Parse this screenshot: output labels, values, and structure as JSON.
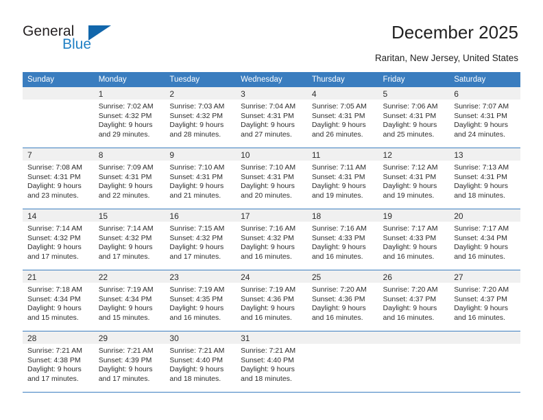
{
  "brand": {
    "general": "General",
    "blue": "Blue",
    "triangle_color": "#1166ab",
    "blue_color": "#1f7fc4"
  },
  "header": {
    "title": "December 2025",
    "subtitle": "Raritan, New Jersey, United States",
    "header_bg": "#3a7dbf"
  },
  "weekdays": [
    "Sunday",
    "Monday",
    "Tuesday",
    "Wednesday",
    "Thursday",
    "Friday",
    "Saturday"
  ],
  "weeks": [
    [
      {
        "day": "",
        "sunrise": "",
        "sunset": "",
        "daylight1": "",
        "daylight2": ""
      },
      {
        "day": "1",
        "sunrise": "Sunrise: 7:02 AM",
        "sunset": "Sunset: 4:32 PM",
        "daylight1": "Daylight: 9 hours",
        "daylight2": "and 29 minutes."
      },
      {
        "day": "2",
        "sunrise": "Sunrise: 7:03 AM",
        "sunset": "Sunset: 4:32 PM",
        "daylight1": "Daylight: 9 hours",
        "daylight2": "and 28 minutes."
      },
      {
        "day": "3",
        "sunrise": "Sunrise: 7:04 AM",
        "sunset": "Sunset: 4:31 PM",
        "daylight1": "Daylight: 9 hours",
        "daylight2": "and 27 minutes."
      },
      {
        "day": "4",
        "sunrise": "Sunrise: 7:05 AM",
        "sunset": "Sunset: 4:31 PM",
        "daylight1": "Daylight: 9 hours",
        "daylight2": "and 26 minutes."
      },
      {
        "day": "5",
        "sunrise": "Sunrise: 7:06 AM",
        "sunset": "Sunset: 4:31 PM",
        "daylight1": "Daylight: 9 hours",
        "daylight2": "and 25 minutes."
      },
      {
        "day": "6",
        "sunrise": "Sunrise: 7:07 AM",
        "sunset": "Sunset: 4:31 PM",
        "daylight1": "Daylight: 9 hours",
        "daylight2": "and 24 minutes."
      }
    ],
    [
      {
        "day": "7",
        "sunrise": "Sunrise: 7:08 AM",
        "sunset": "Sunset: 4:31 PM",
        "daylight1": "Daylight: 9 hours",
        "daylight2": "and 23 minutes."
      },
      {
        "day": "8",
        "sunrise": "Sunrise: 7:09 AM",
        "sunset": "Sunset: 4:31 PM",
        "daylight1": "Daylight: 9 hours",
        "daylight2": "and 22 minutes."
      },
      {
        "day": "9",
        "sunrise": "Sunrise: 7:10 AM",
        "sunset": "Sunset: 4:31 PM",
        "daylight1": "Daylight: 9 hours",
        "daylight2": "and 21 minutes."
      },
      {
        "day": "10",
        "sunrise": "Sunrise: 7:10 AM",
        "sunset": "Sunset: 4:31 PM",
        "daylight1": "Daylight: 9 hours",
        "daylight2": "and 20 minutes."
      },
      {
        "day": "11",
        "sunrise": "Sunrise: 7:11 AM",
        "sunset": "Sunset: 4:31 PM",
        "daylight1": "Daylight: 9 hours",
        "daylight2": "and 19 minutes."
      },
      {
        "day": "12",
        "sunrise": "Sunrise: 7:12 AM",
        "sunset": "Sunset: 4:31 PM",
        "daylight1": "Daylight: 9 hours",
        "daylight2": "and 19 minutes."
      },
      {
        "day": "13",
        "sunrise": "Sunrise: 7:13 AM",
        "sunset": "Sunset: 4:31 PM",
        "daylight1": "Daylight: 9 hours",
        "daylight2": "and 18 minutes."
      }
    ],
    [
      {
        "day": "14",
        "sunrise": "Sunrise: 7:14 AM",
        "sunset": "Sunset: 4:32 PM",
        "daylight1": "Daylight: 9 hours",
        "daylight2": "and 17 minutes."
      },
      {
        "day": "15",
        "sunrise": "Sunrise: 7:14 AM",
        "sunset": "Sunset: 4:32 PM",
        "daylight1": "Daylight: 9 hours",
        "daylight2": "and 17 minutes."
      },
      {
        "day": "16",
        "sunrise": "Sunrise: 7:15 AM",
        "sunset": "Sunset: 4:32 PM",
        "daylight1": "Daylight: 9 hours",
        "daylight2": "and 17 minutes."
      },
      {
        "day": "17",
        "sunrise": "Sunrise: 7:16 AM",
        "sunset": "Sunset: 4:32 PM",
        "daylight1": "Daylight: 9 hours",
        "daylight2": "and 16 minutes."
      },
      {
        "day": "18",
        "sunrise": "Sunrise: 7:16 AM",
        "sunset": "Sunset: 4:33 PM",
        "daylight1": "Daylight: 9 hours",
        "daylight2": "and 16 minutes."
      },
      {
        "day": "19",
        "sunrise": "Sunrise: 7:17 AM",
        "sunset": "Sunset: 4:33 PM",
        "daylight1": "Daylight: 9 hours",
        "daylight2": "and 16 minutes."
      },
      {
        "day": "20",
        "sunrise": "Sunrise: 7:17 AM",
        "sunset": "Sunset: 4:34 PM",
        "daylight1": "Daylight: 9 hours",
        "daylight2": "and 16 minutes."
      }
    ],
    [
      {
        "day": "21",
        "sunrise": "Sunrise: 7:18 AM",
        "sunset": "Sunset: 4:34 PM",
        "daylight1": "Daylight: 9 hours",
        "daylight2": "and 15 minutes."
      },
      {
        "day": "22",
        "sunrise": "Sunrise: 7:19 AM",
        "sunset": "Sunset: 4:34 PM",
        "daylight1": "Daylight: 9 hours",
        "daylight2": "and 15 minutes."
      },
      {
        "day": "23",
        "sunrise": "Sunrise: 7:19 AM",
        "sunset": "Sunset: 4:35 PM",
        "daylight1": "Daylight: 9 hours",
        "daylight2": "and 16 minutes."
      },
      {
        "day": "24",
        "sunrise": "Sunrise: 7:19 AM",
        "sunset": "Sunset: 4:36 PM",
        "daylight1": "Daylight: 9 hours",
        "daylight2": "and 16 minutes."
      },
      {
        "day": "25",
        "sunrise": "Sunrise: 7:20 AM",
        "sunset": "Sunset: 4:36 PM",
        "daylight1": "Daylight: 9 hours",
        "daylight2": "and 16 minutes."
      },
      {
        "day": "26",
        "sunrise": "Sunrise: 7:20 AM",
        "sunset": "Sunset: 4:37 PM",
        "daylight1": "Daylight: 9 hours",
        "daylight2": "and 16 minutes."
      },
      {
        "day": "27",
        "sunrise": "Sunrise: 7:20 AM",
        "sunset": "Sunset: 4:37 PM",
        "daylight1": "Daylight: 9 hours",
        "daylight2": "and 16 minutes."
      }
    ],
    [
      {
        "day": "28",
        "sunrise": "Sunrise: 7:21 AM",
        "sunset": "Sunset: 4:38 PM",
        "daylight1": "Daylight: 9 hours",
        "daylight2": "and 17 minutes."
      },
      {
        "day": "29",
        "sunrise": "Sunrise: 7:21 AM",
        "sunset": "Sunset: 4:39 PM",
        "daylight1": "Daylight: 9 hours",
        "daylight2": "and 17 minutes."
      },
      {
        "day": "30",
        "sunrise": "Sunrise: 7:21 AM",
        "sunset": "Sunset: 4:40 PM",
        "daylight1": "Daylight: 9 hours",
        "daylight2": "and 18 minutes."
      },
      {
        "day": "31",
        "sunrise": "Sunrise: 7:21 AM",
        "sunset": "Sunset: 4:40 PM",
        "daylight1": "Daylight: 9 hours",
        "daylight2": "and 18 minutes."
      },
      {
        "day": "",
        "sunrise": "",
        "sunset": "",
        "daylight1": "",
        "daylight2": ""
      },
      {
        "day": "",
        "sunrise": "",
        "sunset": "",
        "daylight1": "",
        "daylight2": ""
      },
      {
        "day": "",
        "sunrise": "",
        "sunset": "",
        "daylight1": "",
        "daylight2": ""
      }
    ]
  ]
}
